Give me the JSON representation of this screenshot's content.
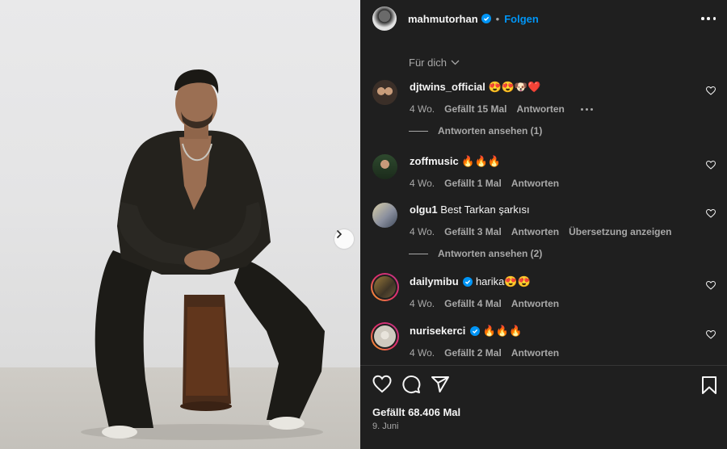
{
  "post": {
    "username": "mahmutorhan",
    "follow_label": "Folgen",
    "next_label": "›",
    "likes_text": "Gefällt 68.406 Mal",
    "date_text": "9. Juni"
  },
  "filter": {
    "label": "Für dich"
  },
  "comments": [
    {
      "user": "djtwins_official",
      "text": "😍😍🐶❤️",
      "age": "4 Wo.",
      "likes": "Gefällt 15 Mal",
      "reply": "Antworten",
      "translate": "",
      "verified": false
    },
    {
      "user": "zoffmusic",
      "text": "🔥🔥🔥",
      "age": "4 Wo.",
      "likes": "Gefällt 1 Mal",
      "reply": "Antworten",
      "translate": "",
      "verified": false
    },
    {
      "user": "olgu1",
      "text": "Best Tarkan şarkısı",
      "age": "4 Wo.",
      "likes": "Gefällt 3 Mal",
      "reply": "Antworten",
      "translate": "Übersetzung anzeigen",
      "verified": false
    },
    {
      "user": "dailymibu",
      "text": "harika😍😍",
      "age": "4 Wo.",
      "likes": "Gefällt 4 Mal",
      "reply": "Antworten",
      "translate": "",
      "verified": true
    },
    {
      "user": "nurisekerci",
      "text": "🔥🔥🔥",
      "age": "4 Wo.",
      "likes": "Gefällt 2 Mal",
      "reply": "Antworten",
      "translate": "",
      "verified": true
    }
  ],
  "view_replies": [
    {
      "label": "Antworten ansehen (1)"
    },
    {
      "label": "Antworten ansehen (2)"
    }
  ],
  "colors": {
    "panel_bg": "#1f1f1f",
    "link_blue": "#0095f6",
    "muted": "#a8a8a8"
  },
  "icons": [
    "verified-icon",
    "more-icon",
    "chevron-down-icon",
    "heart-icon",
    "comment-icon",
    "share-icon",
    "bookmark-icon",
    "chevron-right-icon"
  ]
}
